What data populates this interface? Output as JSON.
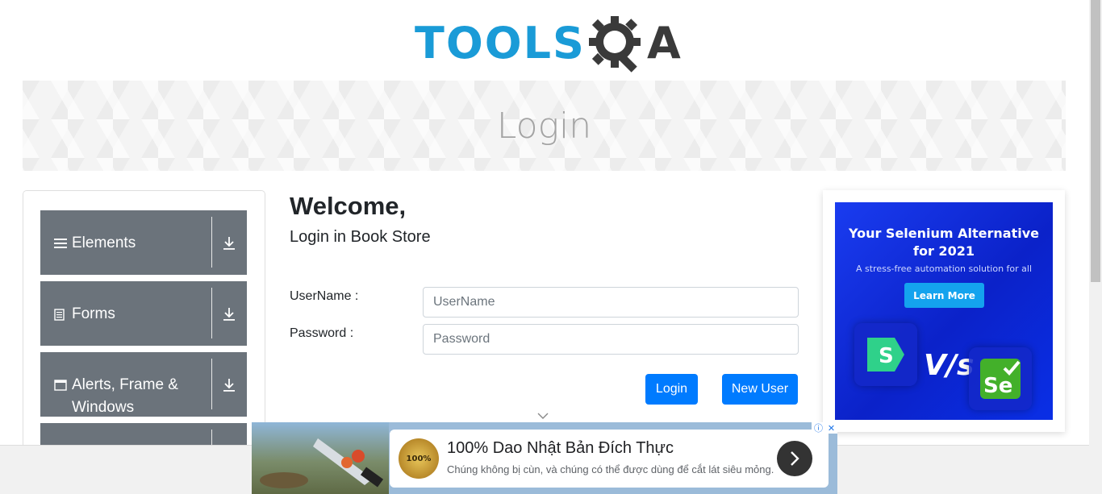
{
  "header": {
    "logo_text": "TOOLS",
    "logo_suffix": "A",
    "logo_alt": "TOOLSQA"
  },
  "banner": {
    "title": "Login"
  },
  "sidebar": {
    "groups": [
      {
        "label": "Elements",
        "icon": "menu-icon"
      },
      {
        "label": "Forms",
        "icon": "document-icon"
      },
      {
        "label": "Alerts, Frame & Windows",
        "icon": "window-icon"
      },
      {
        "label": "",
        "icon": ""
      }
    ]
  },
  "main": {
    "welcome": "Welcome,",
    "subtitle": "Login in Book Store",
    "username_label": "UserName :",
    "username_placeholder": "UserName",
    "password_label": "Password :",
    "password_placeholder": "Password",
    "login_button": "Login",
    "new_user_button": "New User"
  },
  "ad_right": {
    "title": "Your Selenium Alternative for 2021",
    "subtitle": "A stress-free automation solution for all",
    "cta": "Learn More",
    "vs": "V/s"
  },
  "ad_bottom": {
    "badge": "100%",
    "title": "100% Dao Nhật Bản Đích Thực",
    "description": "Chúng không bị cùn, và chúng có thể được dùng để cắt lát siêu mỏng."
  },
  "colors": {
    "brand_blue": "#1a9bd7",
    "group_bg": "#6b737b",
    "button_blue": "#007bff",
    "ad_blue": "#0b22c9"
  }
}
